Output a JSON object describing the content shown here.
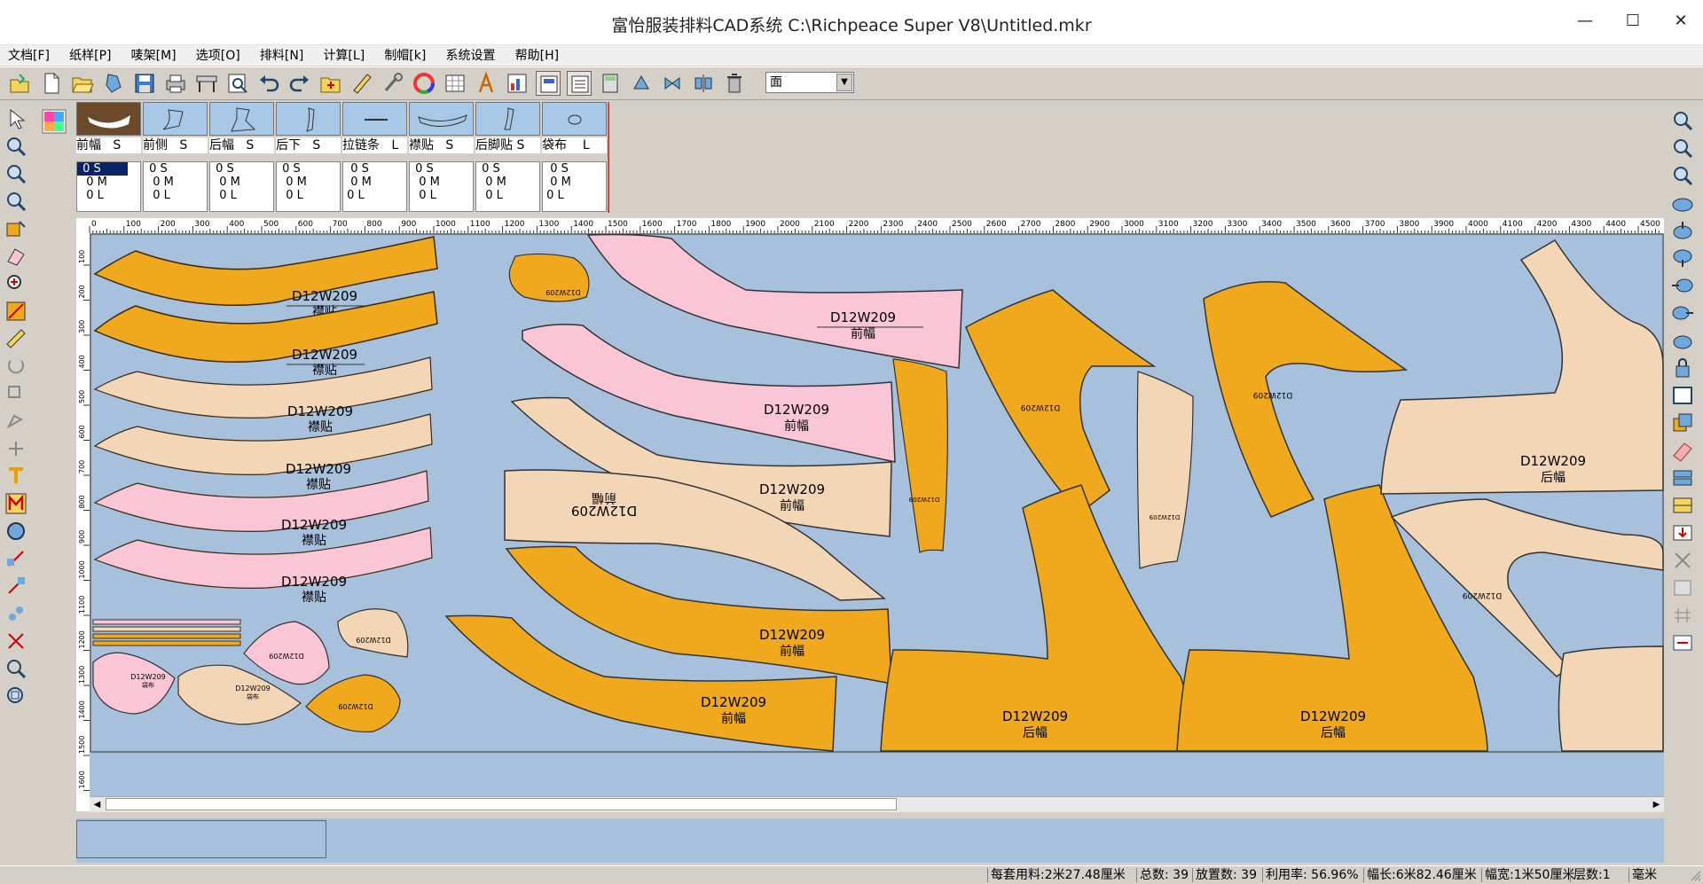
{
  "window": {
    "title": "富怡服装排料CAD系统 C:\\Richpeace Super V8\\Untitled.mkr"
  },
  "menu": [
    "文档[F]",
    "纸样[P]",
    "唛架[M]",
    "选项[O]",
    "排料[N]",
    "计算[L]",
    "制帽[k]",
    "系统设置",
    "帮助[H]"
  ],
  "toolbar": {
    "combo_value": "面"
  },
  "pieces": [
    {
      "name": "前幅",
      "size": "S",
      "num": "1",
      "sizes": [
        " 0 S",
        "  0 M",
        "  0 L"
      ]
    },
    {
      "name": "前侧",
      "size": "S",
      "num": "2",
      "sizes": [
        " 0 S",
        "  0 M",
        "  0 L"
      ]
    },
    {
      "name": "后幅",
      "size": "S",
      "num": "3",
      "sizes": [
        " 0 S",
        "  0 M",
        "  0 L"
      ]
    },
    {
      "name": "后下",
      "size": "S",
      "num": "4",
      "sizes": [
        " 0 S",
        "  0 M",
        "  0 L"
      ]
    },
    {
      "name": "拉链条",
      "size": "L",
      "num": "5",
      "sizes": "  0 S\n  0 M\n 0 L"
    },
    {
      "name": "襟贴",
      "size": "S",
      "num": "6",
      "sizes": [
        " 0 S",
        "  0 M",
        "  0 L"
      ]
    },
    {
      "name": "后脚贴",
      "size": "S",
      "num": "7",
      "sizes": [
        " 0 S",
        "  0 M",
        "  0 L"
      ]
    },
    {
      "name": "袋布",
      "size": "L",
      "num": "8",
      "sizes": "  0 S\n  0 M\n 0 L"
    }
  ],
  "ruler": {
    "h_ticks": [
      "0",
      "100",
      "200",
      "300",
      "400",
      "500",
      "600",
      "700",
      "800",
      "900",
      "1000",
      "1100",
      "1200",
      "1300",
      "1400",
      "1500",
      "1600",
      "1700",
      "1800",
      "1900",
      "2000",
      "2100",
      "2200",
      "2300",
      "2400",
      "2500",
      "2600",
      "2700",
      "2800",
      "2900",
      "3000",
      "3100",
      "3200",
      "3300",
      "3400",
      "3500",
      "3600",
      "3700",
      "3800",
      "3900",
      "4000",
      "4100",
      "4200",
      "4300",
      "4400",
      "4500"
    ],
    "v_ticks": [
      "100",
      "200",
      "300",
      "400",
      "500",
      "600",
      "700",
      "800",
      "900",
      "1000",
      "1100",
      "1200",
      "1300",
      "1400",
      "1500",
      "1600"
    ]
  },
  "marker": {
    "code": "D12W209",
    "labels": {
      "jintie": "襟贴",
      "qianfu": "前幅",
      "houfu": "后幅",
      "qiance": "前侧",
      "daibu": "袋布"
    }
  },
  "status": {
    "per_set": "每套用料:2米27.48厘米",
    "total": "总数: 39",
    "placed": "放置数: 39",
    "rate": "利用率: 56.96%",
    "length": "幅长:6米82.46厘米",
    "width": "幅宽:1米50厘米",
    "layers": "层数:1",
    "unit": "毫米"
  },
  "colors": {
    "canvas_bg": "#a7c0dc",
    "orange": "#f0a81c",
    "tan": "#f3d6b5",
    "pink": "#fac6d6"
  }
}
